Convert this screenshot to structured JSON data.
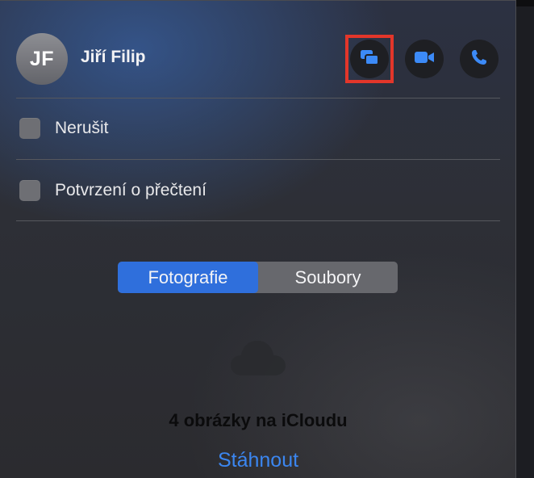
{
  "contact": {
    "initials": "JF",
    "name": "Jiří Filip"
  },
  "actions": [
    {
      "name": "message",
      "icon": "message-bubbles-icon"
    },
    {
      "name": "video",
      "icon": "video-camera-icon"
    },
    {
      "name": "phone",
      "icon": "phone-icon"
    }
  ],
  "options": {
    "do_not_disturb": {
      "label": "Nerušit",
      "checked": false
    },
    "read_receipts": {
      "label": "Potvrzení o přečtení",
      "checked": false
    }
  },
  "segmented": {
    "photos_label": "Fotografie",
    "files_label": "Soubory",
    "selected": "Fotografie"
  },
  "empty_state": {
    "icon": "cloud-icon",
    "title": "4 obrázky na iCloudu",
    "download_label": "Stáhnout"
  },
  "colors": {
    "accent": "#2f6fdc",
    "link": "#3b86f0",
    "highlight": "#e3362a"
  }
}
